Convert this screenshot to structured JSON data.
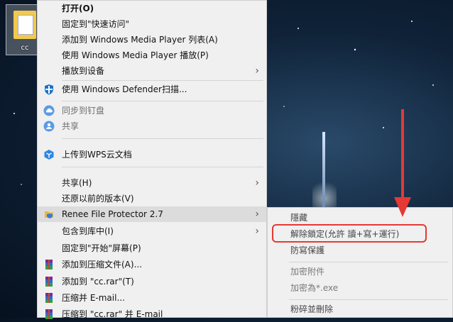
{
  "desktop": {
    "icon_label": "cc"
  },
  "context_menu": {
    "items": [
      {
        "label": "打开(O)",
        "bold": true
      },
      {
        "label": "固定到\"快速访问\""
      },
      {
        "label": "添加到 Windows Media Player 列表(A)"
      },
      {
        "label": "使用 Windows Media Player 播放(P)"
      },
      {
        "label": "播放到设备",
        "submenu": true
      },
      {
        "label": "使用 Windows Defender扫描...",
        "icon": "windows-defender-icon"
      },
      {
        "label": "同步到钉盘",
        "icon": "cloud-sync-icon",
        "disabled": true
      },
      {
        "label": "共享",
        "icon": "share-person-icon",
        "disabled": true
      },
      {
        "label": "上传到WPS云文档",
        "icon": "wps-cloud-icon"
      },
      {
        "label": "共享(H)",
        "submenu": true
      },
      {
        "label": "还原以前的版本(V)"
      },
      {
        "label": "Renee File Protector 2.7",
        "submenu": true,
        "icon": "renee-file-protector-icon"
      },
      {
        "label": "包含到库中(I)",
        "submenu": true
      },
      {
        "label": "固定到\"开始\"屏幕(P)"
      },
      {
        "label": "添加到压缩文件(A)...",
        "icon": "winrar-icon"
      },
      {
        "label": "添加到 \"cc.rar\"(T)",
        "icon": "winrar-icon"
      },
      {
        "label": "压缩并 E-mail...",
        "icon": "winrar-icon"
      },
      {
        "label": "压缩到 \"cc.rar\" 并 E-mail",
        "icon": "winrar-icon"
      }
    ]
  },
  "submenu": {
    "items": [
      {
        "label": "隱藏"
      },
      {
        "label": "解除鎖定(允許 讀+寫+運行)"
      },
      {
        "label": "防寫保護"
      },
      {
        "label": "加密附件",
        "disabled": true
      },
      {
        "label": "加密為*.exe",
        "disabled": true
      },
      {
        "label": "粉碎並刪除"
      }
    ]
  },
  "colors": {
    "highlight": "#e53935",
    "menu_bg": "#f0f0f0"
  }
}
